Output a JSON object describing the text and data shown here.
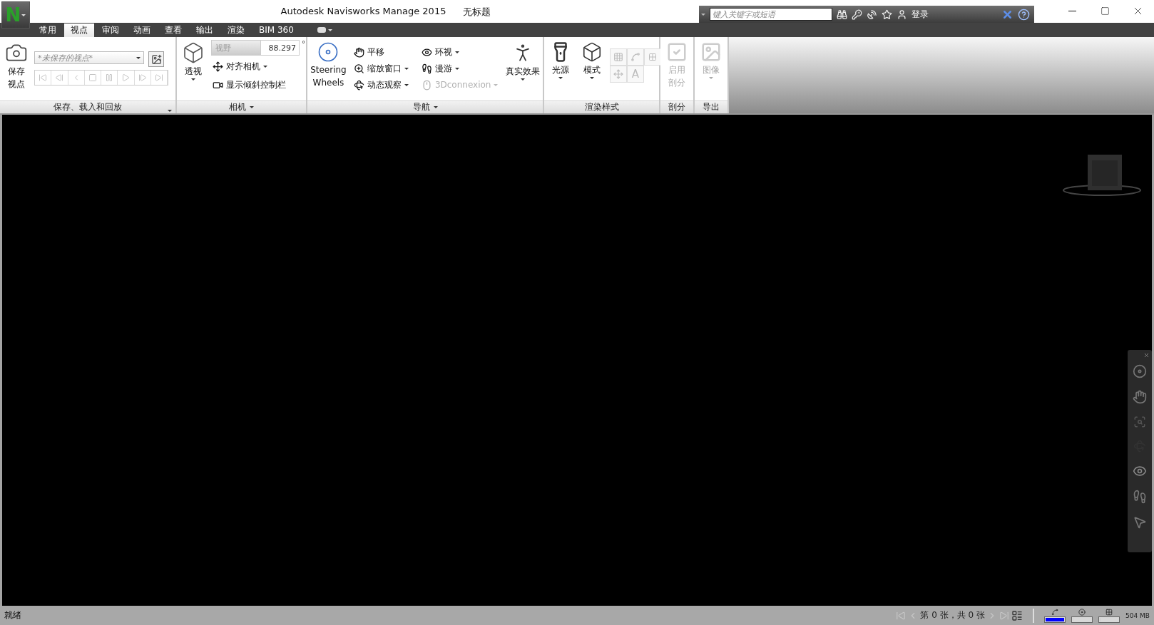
{
  "app_button": {
    "label": "N"
  },
  "window": {
    "title": "Autodesk Navisworks Manage 2015",
    "document": "无标题"
  },
  "search": {
    "placeholder": "键入关键字或短语"
  },
  "sign_in": "登录",
  "tabs": [
    {
      "label": "常用",
      "selected": false
    },
    {
      "label": "视点",
      "selected": true
    },
    {
      "label": "审阅",
      "selected": false
    },
    {
      "label": "动画",
      "selected": false
    },
    {
      "label": "查看",
      "selected": false
    },
    {
      "label": "输出",
      "selected": false
    },
    {
      "label": "渲染",
      "selected": false
    },
    {
      "label": "BIM 360",
      "selected": false
    }
  ],
  "ribbon": {
    "save_panel": {
      "title": "保存、载入和回放",
      "save_button": [
        "保存",
        "视点"
      ],
      "viewpoint": {
        "value": "*未保存的视点*"
      }
    },
    "camera_panel": {
      "title": "相机",
      "perspective": "透视",
      "fov_label": "视野",
      "fov_value": "88.297",
      "fov_unit": "°",
      "align_camera": "对齐相机",
      "show_tilt": "显示倾斜控制栏"
    },
    "navigation_panel": {
      "title": "导航",
      "steering_wheels": [
        "Steering",
        "Wheels"
      ],
      "realism": "真实效果",
      "tools": [
        {
          "label": "平移",
          "kind": "pan",
          "disabled": false,
          "dropdown": false
        },
        {
          "label": "环视",
          "kind": "look",
          "disabled": false,
          "dropdown": true
        },
        {
          "label": "缩放窗口",
          "kind": "zoom",
          "disabled": false,
          "dropdown": true
        },
        {
          "label": "漫游",
          "kind": "walk",
          "disabled": false,
          "dropdown": true
        },
        {
          "label": "动态观察",
          "kind": "orbit",
          "disabled": false,
          "dropdown": true
        },
        {
          "label": "3Dconnexion",
          "kind": "device",
          "disabled": true,
          "dropdown": true
        }
      ]
    },
    "render_panel": {
      "title": "渲染样式",
      "lights": "光源",
      "mode": "模式",
      "text_button": "A"
    },
    "sectioning_panel": {
      "title": "剖分",
      "enable": [
        "启用",
        "剖分"
      ],
      "disabled": true
    },
    "export_panel": {
      "title": "导出",
      "image": "图像",
      "disabled": true
    }
  },
  "status_bar": {
    "text": "就绪",
    "page": "第 0 张，共 0 张",
    "meters": [
      {
        "level": 1
      },
      {
        "level": 0
      },
      {
        "level": 0
      }
    ],
    "memory": "504 MB"
  }
}
